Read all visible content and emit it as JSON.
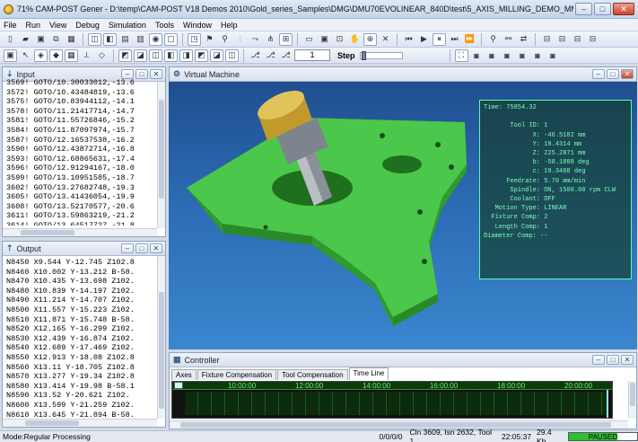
{
  "window": {
    "title": "71% CAM-POST Gener - D:\\temp\\CAM-POST V18 Demos 2010\\Gold_series_Samples\\DMG\\DMU70EVOLINEAR_840D\\test\\5_AXIS_MILLING_DEMO_MM\\5_AXIS_MILLING_DEMO_MM...",
    "min": "–",
    "max": "□",
    "close": "✕"
  },
  "menu": [
    "File",
    "Run",
    "View",
    "Debug",
    "Simulation",
    "Tools",
    "Window",
    "Help"
  ],
  "toolbar2": {
    "step_value": "1",
    "step_label": "Step"
  },
  "input": {
    "title": "Input",
    "lines": [
      "3569! GOTO/10.30033012,-13.6",
      "3572! GOTO/10.43484819,-13.6",
      "3575! GOTO/10.83944112,-14.1",
      "3578! GOTO/11.21417714,-14.7",
      "3581! GOTO/11.55726846,-15.2",
      "3584! GOTO/11.87097974,-15.7",
      "3587! GOTO/12.16537538,-16.2",
      "3590! GOTO/12.43872714,-16.8",
      "3593! GOTO/12.68865631,-17.4",
      "3596! GOTO/12.91294167,-18.0",
      "3599! GOTO/13.10951585,-18.7",
      "3602! GOTO/13.27682748,-19.3",
      "3605! GOTO/13.41436054,-19.9",
      "3608! GOTO/13.52170577,-20.6",
      "3611! GOTO/13.59863219,-21.2",
      "3614! GOTO/13.64517727,-21.8"
    ]
  },
  "output": {
    "title": "Output",
    "lines": [
      "N8450 X9.544 Y-12.745 Z102.8",
      "N8460 X10.002 Y-13.212 B-58.",
      "N8470 X10.435 Y-13.698 Z102.",
      "N8480 X10.839 Y-14.197 Z102.",
      "N8490 X11.214 Y-14.707 Z102.",
      "N8500 X11.557 Y-15.223 Z102.",
      "N8510 X11.871 Y-15.748 B-58.",
      "N8520 X12.165 Y-16.299 Z102.",
      "N8530 X12.439 Y-16.874 Z102.",
      "N8540 X12.689 Y-17.469 Z102.",
      "N8550 X12.913 Y-18.08 Z102.8",
      "N8560 X13.11 Y-18.705 Z102.8",
      "N8570 X13.277 Y-19.34 Z102.8",
      "N8580 X13.414 Y-19.98 B-58.1",
      "N8590 X13.52 Y-20.621 Z102.",
      "N8600 X13.599 Y-21.259 Z102.",
      "N8610 X13.645 Y-21.894 B-58."
    ]
  },
  "vm": {
    "title": "Virtual Machine",
    "info": [
      "Time: 75854.32",
      "",
      "       Tool ID: 1",
      "             X: -46.5182 mm",
      "             Y: 18.4314 mm",
      "             Z: 225.2871 mm",
      "             b: -58.1888 deg",
      "             c: 19.3488 deg",
      "      Feedrate: 5.70 mm/min",
      "       Spindle: ON, 1500.00 rpm CLW",
      "       Coolant: OFF",
      "   Motion Type: LINEAR",
      "  Fixture Comp: 2",
      "   Length Comp: 1",
      "Diameter Comp: --"
    ]
  },
  "controller": {
    "title": "Controller",
    "tabs": [
      "Axes",
      "Fixture Compensation",
      "Tool Compensation",
      "Time Line"
    ],
    "active_tab": "Time Line",
    "times": [
      "10:00:00",
      "12:00:00",
      "14:00:00",
      "16:00:00",
      "18:00:00",
      "20:00:00"
    ]
  },
  "status": {
    "mode": "Mode:Regular Processing",
    "position": "0/0/0/0",
    "info": "Cln 3609, Isn 2632, Tool 1",
    "clock": "22:05:37",
    "mem": "29.4 Kb",
    "state": "PAUSED",
    "progress": 0.71
  },
  "colors": {
    "part": "#3fb63f",
    "bg_top": "#1f4f8f",
    "bg_bottom": "#3a87cf"
  }
}
